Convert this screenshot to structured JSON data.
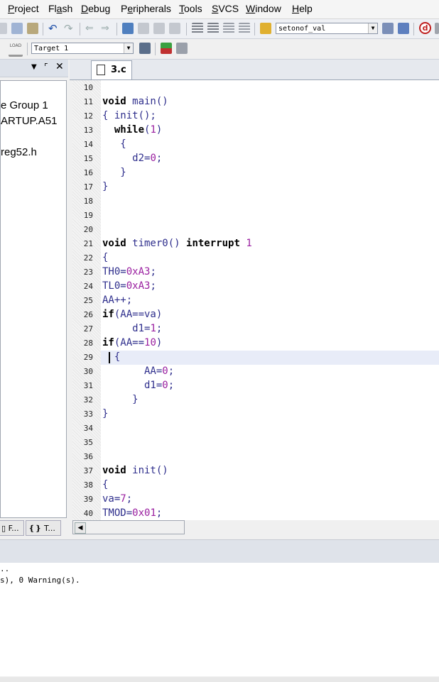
{
  "menu": [
    {
      "label": "Project",
      "hotkey_index": 0
    },
    {
      "label": "Flash",
      "hotkey_index": 2
    },
    {
      "label": "Debug",
      "hotkey_index": 0
    },
    {
      "label": "Peripherals",
      "hotkey_index": 1
    },
    {
      "label": "Tools",
      "hotkey_index": 0
    },
    {
      "label": "SVCS",
      "hotkey_index": 0
    },
    {
      "label": "Window",
      "hotkey_index": 0
    },
    {
      "label": "Help",
      "hotkey_index": 0
    }
  ],
  "toolbar": {
    "find_combo_value": "setonof_val",
    "target_combo_value": "Target 1",
    "load_label": "LOAD"
  },
  "project_tree": {
    "items": [
      "e Group 1",
      "ARTUP.A51",
      "reg52.h"
    ]
  },
  "project_tabs": [
    {
      "label": "F...",
      "icon": "files-icon"
    },
    {
      "label": "T...",
      "icon": "templates-icon"
    }
  ],
  "editor": {
    "file_tab": "3.c",
    "current_line": 29,
    "lines": [
      {
        "n": "10",
        "code": ""
      },
      {
        "n": "11",
        "code": "void main()"
      },
      {
        "n": "12",
        "code": "{ init();"
      },
      {
        "n": "13",
        "code": "  while(1)"
      },
      {
        "n": "14",
        "code": "   {"
      },
      {
        "n": "15",
        "code": "     d2=0;"
      },
      {
        "n": "16",
        "code": "   }"
      },
      {
        "n": "17",
        "code": "}"
      },
      {
        "n": "18",
        "code": ""
      },
      {
        "n": "19",
        "code": ""
      },
      {
        "n": "20",
        "code": ""
      },
      {
        "n": "21",
        "code": "void timer0() interrupt 1"
      },
      {
        "n": "22",
        "code": "{"
      },
      {
        "n": "23",
        "code": "TH0=0xA3;"
      },
      {
        "n": "24",
        "code": "TL0=0xA3;"
      },
      {
        "n": "25",
        "code": "AA++;"
      },
      {
        "n": "26",
        "code": "if(AA==va)"
      },
      {
        "n": "27",
        "code": "     d1=1;"
      },
      {
        "n": "28",
        "code": "if(AA==10)"
      },
      {
        "n": "29",
        "code": "  {"
      },
      {
        "n": "30",
        "code": "       AA=0;"
      },
      {
        "n": "31",
        "code": "       d1=0;"
      },
      {
        "n": "32",
        "code": "     }"
      },
      {
        "n": "33",
        "code": "}"
      },
      {
        "n": "34",
        "code": ""
      },
      {
        "n": "35",
        "code": ""
      },
      {
        "n": "36",
        "code": ""
      },
      {
        "n": "37",
        "code": "void init()"
      },
      {
        "n": "38",
        "code": "{"
      },
      {
        "n": "39",
        "code": "va=7;"
      },
      {
        "n": "40",
        "code": "TMOD=0x01;"
      }
    ]
  },
  "build_output": {
    "lines": [
      ".. ",
      "s), 0 Warning(s)."
    ]
  },
  "colors": {
    "keyword": "#000000",
    "number": "#9a1fa0",
    "identifier": "#2e2e8c",
    "current_line_bg": "#e8ecf8"
  }
}
